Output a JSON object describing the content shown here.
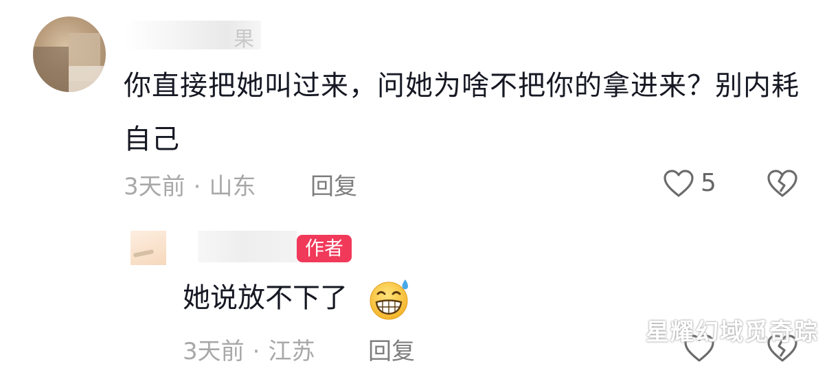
{
  "comment": {
    "username_visible": "果",
    "text": "你直接把她叫过来，问她为啥不把你的拿进来？别内耗自己",
    "time": "3天前",
    "location": "山东",
    "separator": "·",
    "reply_label": "回复",
    "like_count": "5",
    "like_icon": "heart-outline-icon",
    "dislike_icon": "broken-heart-icon"
  },
  "reply": {
    "badge": "作者",
    "text": "她说放不下了",
    "emoji": "grinning-face-with-sweat",
    "time": "3天前",
    "location": "江苏",
    "separator": "·",
    "reply_label": "回复"
  },
  "watermark": "星耀幻域觅奇踪",
  "colors": {
    "text_primary": "#161823",
    "text_meta": "#a8a8a8",
    "author_badge": "#f1395a",
    "background": "#ffffff"
  }
}
